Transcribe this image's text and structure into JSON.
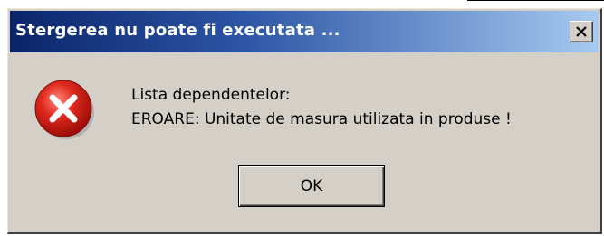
{
  "window": {
    "title": "Stergerea nu poate fi executata ...",
    "close_icon": "close-icon"
  },
  "message": {
    "icon": "error-icon",
    "line1": "Lista dependentelor:",
    "line2": "EROARE: Unitate de masura utilizata in produse !"
  },
  "buttons": {
    "ok_label": "OK"
  },
  "colors": {
    "titlebar_start": "#0a246a",
    "titlebar_end": "#a6caf0",
    "dialog_bg": "#d4d0c8",
    "error_red": "#d81e1e"
  }
}
